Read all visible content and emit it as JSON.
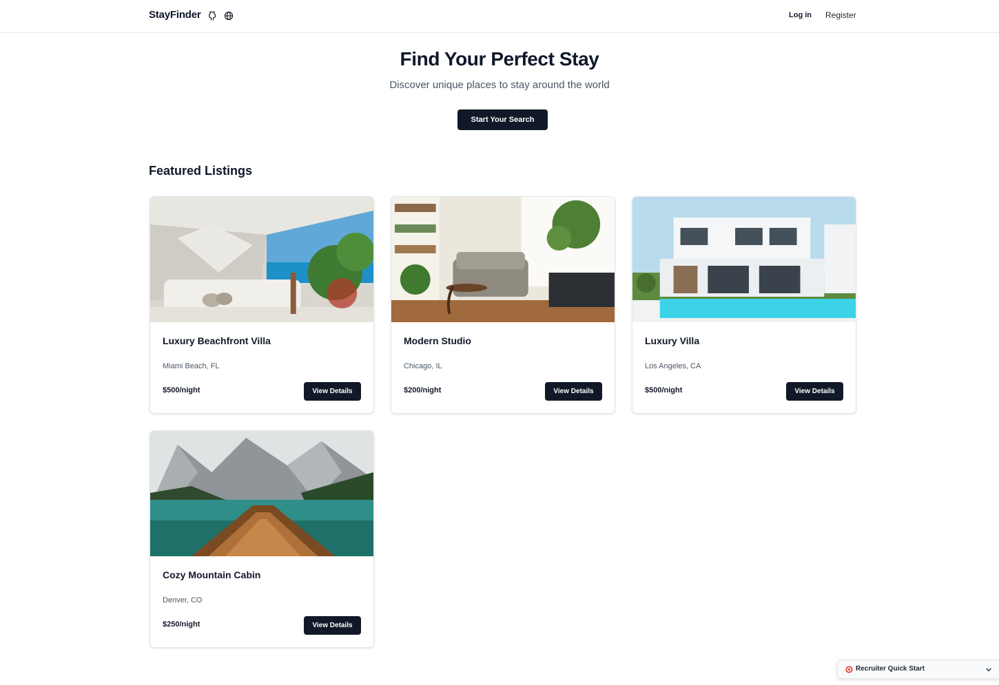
{
  "header": {
    "brand": "StayFinder",
    "icons": [
      "github-icon",
      "globe-icon"
    ],
    "login_label": "Log in",
    "register_label": "Register"
  },
  "hero": {
    "title": "Find Your Perfect Stay",
    "subtitle": "Discover unique places to stay around the world",
    "cta_label": "Start Your Search"
  },
  "featured": {
    "title": "Featured Listings",
    "listings": [
      {
        "title": "Luxury Beachfront Villa",
        "location": "Miami Beach, FL",
        "price": "$500/night",
        "button_label": "View Details",
        "image": "beach-canopy-daybed-photo"
      },
      {
        "title": "Modern Studio",
        "location": "Chicago, IL",
        "price": "$200/night",
        "button_label": "View Details",
        "image": "living-room-sofa-plants-photo"
      },
      {
        "title": "Luxury Villa",
        "location": "Los Angeles, CA",
        "price": "$500/night",
        "button_label": "View Details",
        "image": "white-villa-pool-photo"
      },
      {
        "title": "Cozy Mountain Cabin",
        "location": "Denver, CO",
        "price": "$250/night",
        "button_label": "View Details",
        "image": "mountain-lake-boat-photo"
      }
    ]
  },
  "quick_start": {
    "label": "Recruiter Quick Start",
    "icon": "target-icon"
  },
  "colors": {
    "primary": "#111827",
    "text_muted": "#4b5563",
    "border": "#e5e7eb"
  }
}
